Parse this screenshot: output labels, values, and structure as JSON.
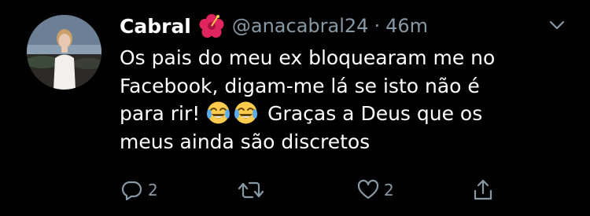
{
  "tweet": {
    "author_name": "Cabral",
    "handle": "@anacabral24",
    "separator": "·",
    "time": "46m",
    "lines": [
      "Os pais do meu ex bloquearam me no",
      "Facebook, digam-me lá se isto não é",
      "para rir!",
      "Graças a Deus que os",
      "meus ainda são discretos"
    ],
    "name_emoji": "hibiscus-icon",
    "text_emojis": [
      "face-with-tears-of-joy-icon",
      "face-with-tears-of-joy-icon"
    ]
  },
  "actions": {
    "reply_count": "2",
    "like_count": "2"
  },
  "colors": {
    "background": "#000000",
    "text": "#ffffff",
    "secondary": "#8899a6"
  }
}
